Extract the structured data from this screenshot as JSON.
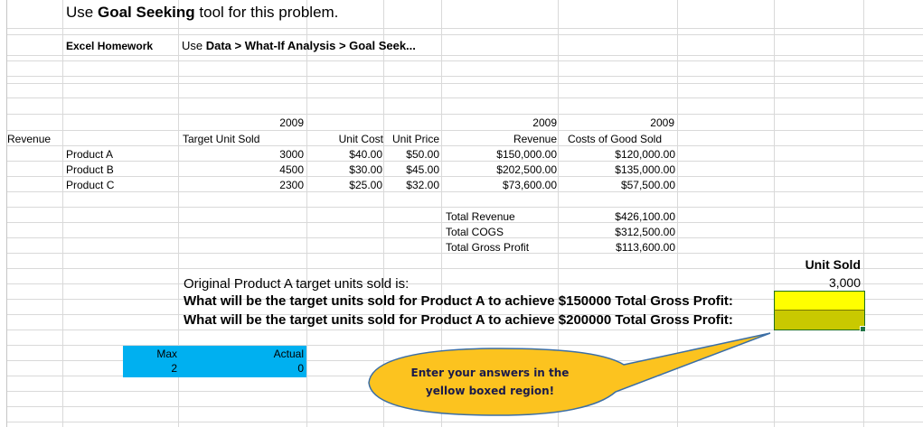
{
  "header": {
    "title_pre": "Use ",
    "title_bold": "Goal Seeking",
    "title_post": " tool for this problem.",
    "homework_label": "Excel Homework",
    "instruction_pre": "Use ",
    "instruction_bold": "Data > What-If Analysis > Goal Seek..."
  },
  "table": {
    "revenue_label": "Revenue",
    "year_target": "2009",
    "year_revenue": "2009",
    "year_cogs": "2009",
    "col_target": "Target Unit Sold",
    "col_unit_cost": "Unit Cost",
    "col_unit_price": "Unit Price",
    "col_revenue": "Revenue",
    "col_cogs": "Costs of Good Sold",
    "rows": [
      {
        "product": "Product A",
        "target": "3000",
        "unit_cost": "$40.00",
        "unit_price": "$50.00",
        "revenue": "$150,000.00",
        "cogs": "$120,000.00"
      },
      {
        "product": "Product B",
        "target": "4500",
        "unit_cost": "$30.00",
        "unit_price": "$45.00",
        "revenue": "$202,500.00",
        "cogs": "$135,000.00"
      },
      {
        "product": "Product C",
        "target": "2300",
        "unit_cost": "$25.00",
        "unit_price": "$32.00",
        "revenue": "$73,600.00",
        "cogs": "$57,500.00"
      }
    ]
  },
  "totals": {
    "revenue_label": "Total Revenue",
    "revenue_value": "$426,100.00",
    "cogs_label": "Total COGS",
    "cogs_value": "$312,500.00",
    "gross_label": "Total Gross Profit",
    "gross_value": "$113,600.00"
  },
  "questions": {
    "original": "Original Product A target units sold is:",
    "q1": "What will be the target units sold for Product A to achieve $150000 Total Gross Profit:",
    "q2": "What will be the target units sold for Product A to achieve $200000 Total Gross Profit:",
    "unit_sold_header": "Unit Sold",
    "original_value": "3,000",
    "answer1": "",
    "answer2": ""
  },
  "max_actual": {
    "max_label": "Max",
    "max_value": "2",
    "actual_label": "Actual",
    "actual_value": "0"
  },
  "callout": {
    "line1": "Enter your answers in the",
    "line2": "yellow boxed region!"
  },
  "colors": {
    "gridline": "#d9d9d9",
    "blue_fill": "#00b0f0",
    "yellow_fill": "#ffff00",
    "olive_fill": "#c9c900",
    "callout_fill": "#fcc31f",
    "callout_border": "#3b6ea5"
  }
}
